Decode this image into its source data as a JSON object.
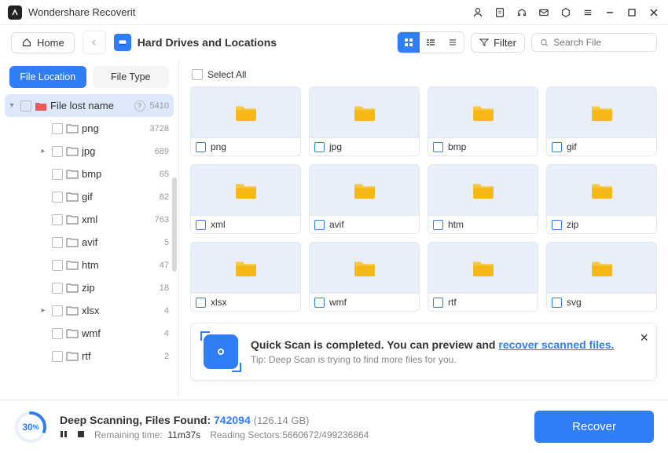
{
  "app": {
    "name": "Wondershare Recoverit"
  },
  "toolbar": {
    "home": "Home",
    "breadcrumb": "Hard Drives and Locations",
    "filter": "Filter",
    "search_placeholder": "Search File"
  },
  "sidebar": {
    "tabs": {
      "location": "File Location",
      "type": "File Type"
    },
    "root": {
      "label": "File lost name",
      "count": "5410"
    },
    "items": [
      {
        "label": "png",
        "count": "3728",
        "expandable": false
      },
      {
        "label": "jpg",
        "count": "689",
        "expandable": true
      },
      {
        "label": "bmp",
        "count": "65",
        "expandable": false
      },
      {
        "label": "gif",
        "count": "82",
        "expandable": false
      },
      {
        "label": "xml",
        "count": "763",
        "expandable": false
      },
      {
        "label": "avif",
        "count": "5",
        "expandable": false
      },
      {
        "label": "htm",
        "count": "47",
        "expandable": false
      },
      {
        "label": "zip",
        "count": "18",
        "expandable": false
      },
      {
        "label": "xlsx",
        "count": "4",
        "expandable": true
      },
      {
        "label": "wmf",
        "count": "4",
        "expandable": false
      },
      {
        "label": "rtf",
        "count": "2",
        "expandable": false
      }
    ]
  },
  "content": {
    "select_all": "Select All",
    "folders": [
      {
        "name": "png"
      },
      {
        "name": "jpg"
      },
      {
        "name": "bmp"
      },
      {
        "name": "gif"
      },
      {
        "name": "xml"
      },
      {
        "name": "avif"
      },
      {
        "name": "htm"
      },
      {
        "name": "zip"
      },
      {
        "name": "xlsx"
      },
      {
        "name": "wmf"
      },
      {
        "name": "rtf"
      },
      {
        "name": "svg"
      }
    ]
  },
  "banner": {
    "title_pre": "Quick Scan is completed. You can preview and ",
    "link": "recover scanned files.",
    "sub": "Tip: Deep Scan is trying to find more files for you."
  },
  "footer": {
    "progress_pct": "30",
    "progress_suffix": "%",
    "scan_label": "Deep Scanning, Files Found: ",
    "files_found": "742094",
    "size": "(126.14 GB)",
    "remaining_label": "Remaining time:",
    "remaining_value": "11m37s",
    "sectors": "Reading Sectors:5660672/499236864",
    "recover": "Recover"
  }
}
